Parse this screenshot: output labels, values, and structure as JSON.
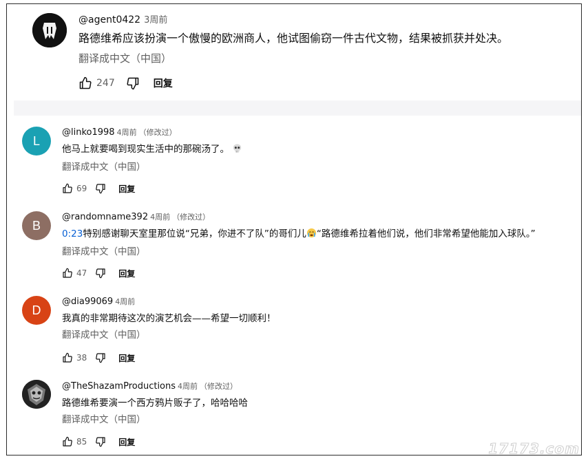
{
  "top_comment": {
    "author": "@agent0422",
    "time": "3周前",
    "text": "路德维希应该扮演一个傲慢的欧洲商人，他试图偷窃一件古代文物，结果被抓获并处决。",
    "translate": "翻译成中文（中国）",
    "likes": "247",
    "reply": "回复"
  },
  "comments": [
    {
      "avatar_letter": "L",
      "avatar_color": "#1aa1b3",
      "author": "@linko1998",
      "time": "4周前",
      "edited": "（修改过）",
      "text": "他马上就要喝到现实生活中的那碗汤了。",
      "emoji": "skull",
      "translate": "翻译成中文（中国）",
      "likes": "69",
      "reply": "回复"
    },
    {
      "avatar_letter": "B",
      "avatar_color": "#8d6e63",
      "author": "@randomname392",
      "time": "4周前",
      "edited": "（修改过）",
      "timestamp_link": "0:23",
      "text_a": "特别感谢聊天室里那位说“兄弟，你进不了队”的哥们儿",
      "text_b": "“路德维希拉着他们说，他们非常希望他能加入球队。”",
      "emoji": "crying-face",
      "translate": "翻译成中文（中国）",
      "likes": "47",
      "reply": "回复"
    },
    {
      "avatar_letter": "D",
      "avatar_color": "#d84315",
      "author": "@dia99069",
      "time": "4周前",
      "text": "我真的非常期待这次的演艺机会——希望一切顺利！",
      "translate": "翻译成中文（中国）",
      "likes": "38",
      "reply": "回复"
    },
    {
      "author": "@TheShazamProductions",
      "time": "4周前",
      "edited": "（修改过）",
      "text": "路德维希要演一个西方鸦片贩子了，哈哈哈哈",
      "translate": "翻译成中文（中国）",
      "likes": "85",
      "reply": "回复"
    }
  ],
  "watermark": "17173.com",
  "colors": {
    "link": "#065fd4",
    "secondary_text": "#606060",
    "separator": "#f5f5f7"
  }
}
